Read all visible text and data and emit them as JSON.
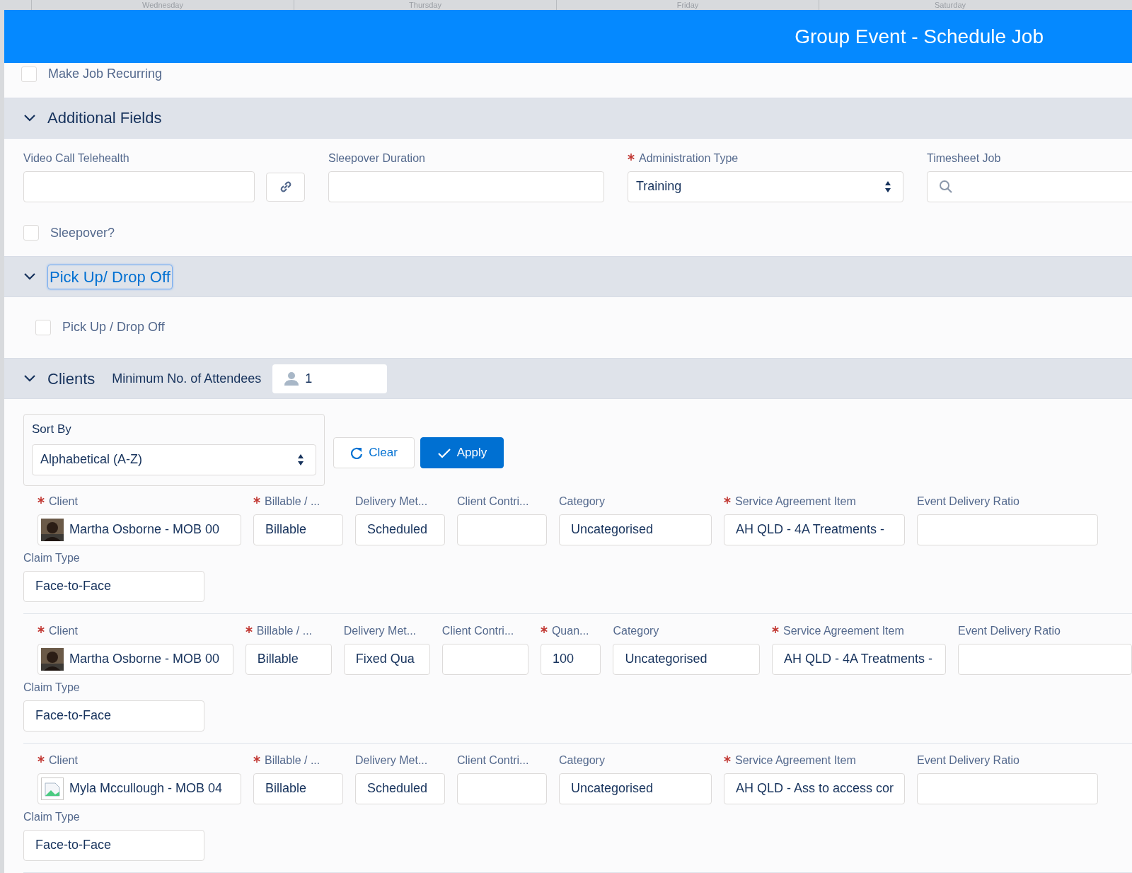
{
  "calendar_header": {
    "days": [
      "Wednesday",
      "Thursday",
      "Friday",
      "Saturday"
    ]
  },
  "dialog": {
    "title": "Group Event - Schedule Job"
  },
  "recurring": {
    "label": "Make Job Recurring",
    "checked": false
  },
  "additional_fields": {
    "title": "Additional Fields",
    "expanded": true,
    "video_call": {
      "label": "Video Call Telehealth"
    },
    "sleepover_duration": {
      "label": "Sleepover Duration"
    },
    "administration_type": {
      "label": "Administration Type",
      "required": true,
      "value": "Training"
    },
    "timesheet_job": {
      "label": "Timesheet Job"
    },
    "sleepover": {
      "label": "Sleepover?",
      "checked": false
    }
  },
  "pickup": {
    "title": "Pick Up/ Drop Off",
    "expanded": true,
    "focused": true,
    "checkbox": {
      "label": "Pick Up / Drop Off",
      "checked": false
    }
  },
  "clients": {
    "title": "Clients",
    "expanded": true,
    "min_attendees": {
      "label": "Minimum No. of Attendees",
      "value": "1"
    },
    "sort": {
      "label": "Sort By",
      "value": "Alphabetical (A-Z)"
    },
    "buttons": [
      {
        "label": "Clear",
        "kind": "clear"
      },
      {
        "label": "Apply",
        "kind": "apply"
      }
    ],
    "rows": [
      {
        "photo": true,
        "fields": [
          {
            "kind": "client",
            "label": "Client",
            "required": true,
            "value": "Martha Osborne - MOB 00"
          },
          {
            "kind": "billable",
            "label": "Billable / ...",
            "required": true,
            "value": "Billable"
          },
          {
            "kind": "delivery",
            "label": "Delivery Met...",
            "required": false,
            "value": "Scheduled"
          },
          {
            "kind": "contribution",
            "label": "Client Contri...",
            "required": false
          },
          {
            "kind": "category",
            "label": "Category",
            "required": false,
            "value": "Uncategorised"
          },
          {
            "kind": "service",
            "label": "Service Agreement Item",
            "required": true,
            "value": "AH QLD - 4A Treatments -"
          },
          {
            "kind": "ratio",
            "label": "Event Delivery Ratio",
            "required": false
          }
        ],
        "claim_type": {
          "label": "Claim Type",
          "value": "Face-to-Face"
        }
      },
      {
        "photo": true,
        "fields": [
          {
            "kind": "client",
            "label": "Client",
            "required": true,
            "value": "Martha Osborne - MOB 00"
          },
          {
            "kind": "billable",
            "label": "Billable / ...",
            "required": true,
            "value": "Billable"
          },
          {
            "kind": "delivery",
            "label": "Delivery Met...",
            "required": false,
            "value": "Fixed Qua"
          },
          {
            "kind": "contribution",
            "label": "Client Contri...",
            "required": false
          },
          {
            "kind": "quantity",
            "label": "Quan...",
            "required": true,
            "value": "100"
          },
          {
            "kind": "category",
            "label": "Category",
            "required": false,
            "value": "Uncategorised"
          },
          {
            "kind": "service",
            "label": "Service Agreement Item",
            "required": true,
            "value": "AH QLD - 4A Treatments -"
          },
          {
            "kind": "ratio",
            "label": "Event Delivery Ratio",
            "required": false
          }
        ],
        "claim_type": {
          "label": "Claim Type",
          "value": "Face-to-Face"
        }
      },
      {
        "photo": false,
        "fields": [
          {
            "kind": "client",
            "label": "Client",
            "required": true,
            "value": "Myla Mccullough - MOB 04"
          },
          {
            "kind": "billable",
            "label": "Billable / ...",
            "required": true,
            "value": "Billable"
          },
          {
            "kind": "delivery",
            "label": "Delivery Met...",
            "required": false,
            "value": "Scheduled"
          },
          {
            "kind": "contribution",
            "label": "Client Contri...",
            "required": false
          },
          {
            "kind": "category",
            "label": "Category",
            "required": false,
            "value": "Uncategorised"
          },
          {
            "kind": "service",
            "label": "Service Agreement Item",
            "required": true,
            "value": "AH QLD - Ass to access cor"
          },
          {
            "kind": "ratio",
            "label": "Event Delivery Ratio",
            "required": false
          }
        ],
        "claim_type": {
          "label": "Claim Type",
          "value": "Face-to-Face"
        }
      }
    ]
  }
}
